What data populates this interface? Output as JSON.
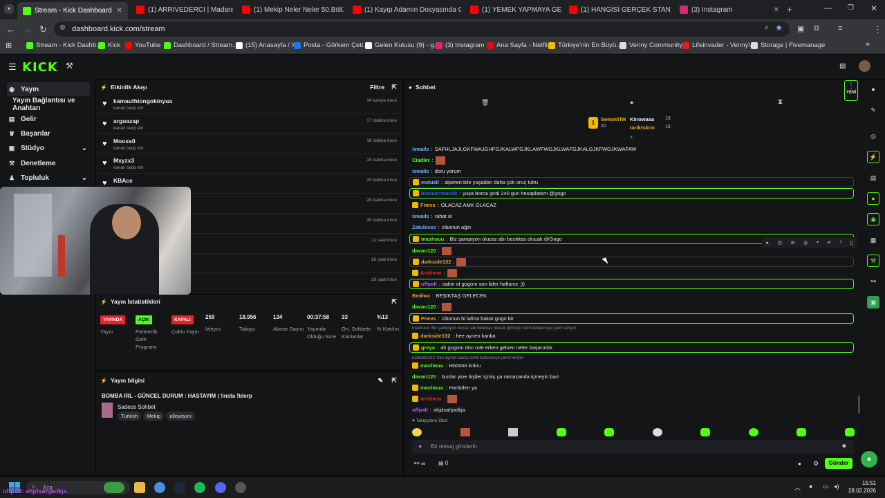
{
  "browser": {
    "tabs": [
      {
        "label": "Stream - Kick Dashboard",
        "icon": "kick-icon",
        "color": "#53fc18"
      },
      {
        "label": "(1) ARRIVEDERCI | Madara Oldu",
        "icon": "youtube-icon",
        "color": "#ff0000"
      },
      {
        "label": "(1) Mekip Neler Neler 50.Bölüm",
        "icon": "youtube-icon",
        "color": "#ff0000"
      },
      {
        "label": "(1) Kayıp Adamın Dosyasında G",
        "icon": "youtube-icon",
        "color": "#ff0000"
      },
      {
        "label": "(1) YEMEK YAPMAYA GELDİK, D",
        "icon": "youtube-icon",
        "color": "#ff0000"
      },
      {
        "label": "(1) HANGİSİ GERÇEK STAND-U",
        "icon": "youtube-icon",
        "color": "#ff0000"
      },
      {
        "label": "(3) Instagram",
        "icon": "instagram-icon",
        "color": "#d62976"
      }
    ],
    "url": "dashboard.kick.com/stream",
    "bookmarks": [
      {
        "label": "Stream - Kick Dashb...",
        "color": "#53fc18"
      },
      {
        "label": "Kick",
        "color": "#53fc18"
      },
      {
        "label": "YouTube",
        "color": "#ff0000"
      },
      {
        "label": "Dashboard / Stream...",
        "color": "#53fc18"
      },
      {
        "label": "(15) Anasayfa / X",
        "color": "#ffffff"
      },
      {
        "label": "Posta - Görkem Çeti...",
        "color": "#1e73e8"
      },
      {
        "label": "Gelen Kutusu (9) - g...",
        "color": "#ffffff"
      },
      {
        "label": "(3) Instagram",
        "color": "#d62976"
      },
      {
        "label": "Ana Sayfa - Netflix",
        "color": "#e50914"
      },
      {
        "label": "Türkiye'nin En Büyü...",
        "color": "#f0c000"
      },
      {
        "label": "Venny Community",
        "color": "#dddddd"
      },
      {
        "label": "Lifeinvader - VennyV",
        "color": "#e02020"
      },
      {
        "label": "Storage | Fivemanage",
        "color": "#dddddd"
      }
    ]
  },
  "kick": {
    "logo": "KICK",
    "nav": [
      {
        "label": "Yayın",
        "icon": "broadcast-icon",
        "active": true
      },
      {
        "label": "Yayın Bağlantısı ve Anahtarı",
        "icon": "",
        "active": false
      },
      {
        "label": "Gelir",
        "icon": "money-icon",
        "active": false
      },
      {
        "label": "Başarılar",
        "icon": "trophy-icon",
        "active": false
      },
      {
        "label": "Stüdyo",
        "icon": "studio-icon",
        "active": false
      },
      {
        "label": "Denetleme",
        "icon": "hammer-icon",
        "active": false
      },
      {
        "label": "Topluluk",
        "icon": "community-icon",
        "active": false
      }
    ]
  },
  "activity": {
    "title": "Etkinlik Akışı",
    "filter": "Filtre",
    "events": [
      {
        "name": "kamauthiongokinyua",
        "sub": "kanalı takip etti",
        "time": "34 saniye önce"
      },
      {
        "name": "argoazap",
        "sub": "kanalı takip etti",
        "time": "17 dakika önce"
      },
      {
        "name": "Mooss0",
        "sub": "kanalı takip etti",
        "time": "18 dakika önce"
      },
      {
        "name": "Mxyzx3",
        "sub": "kanalı takip etti",
        "time": "19 dakika önce"
      },
      {
        "name": "KBAce",
        "sub": "",
        "time": "20 dakika önce"
      },
      {
        "name": "",
        "sub": "",
        "time": "28 dakika önce"
      },
      {
        "name": "",
        "sub": "",
        "time": "35 dakika önce"
      },
      {
        "name": "",
        "sub": "",
        "time": "11 saat önce"
      },
      {
        "name": "",
        "sub": "",
        "time": "18 saat önce"
      },
      {
        "name": "",
        "sub": "",
        "time": "18 saat önce"
      }
    ]
  },
  "stats": {
    "title": "Yayın İstatistikleri",
    "badges": [
      {
        "text": "YAYINDA",
        "label": "Yayın",
        "bg": "#e5252a",
        "fg": "#ffffff"
      },
      {
        "text": "AÇIK",
        "label": "Partnerlik Gelir Programı",
        "bg": "#53fc18",
        "fg": "#000000"
      },
      {
        "text": "KAPALI",
        "label": "Çoklu Yayın",
        "bg": "#e5252a",
        "fg": "#ffffff"
      }
    ],
    "values": [
      {
        "value": "259",
        "label": "İzleyici"
      },
      {
        "value": "18.956",
        "label": "Takipçi"
      },
      {
        "value": "134",
        "label": "Abone Sayısı"
      },
      {
        "value": "00:37:58",
        "label": "Yayında Olduğu Süre"
      },
      {
        "value": "33",
        "label": "Ort. Sohbete Katılanlar"
      },
      {
        "value": "%13",
        "label": "% Katılım"
      }
    ]
  },
  "info": {
    "title": "Yayın bilgisi",
    "stream_title": "BOMBA IRL - GÜNCEL DURUM : HASTAYIM | !insta !blerp",
    "category": "Sadece Sohbet",
    "tags": [
      "Turkish",
      "Mekip",
      "alleyayını"
    ]
  },
  "chat": {
    "title": "Sohbet",
    "new_label": "YENİ",
    "top": [
      {
        "name": "SenseiiTR",
        "count": "20",
        "rank": "1"
      },
      {
        "name": "Kinowaaa",
        "count": "16"
      },
      {
        "name": "tariktsknn",
        "count": "16"
      }
    ],
    "messages": [
      {
        "user": "iswails",
        "text": "SAFHLJAJLGKFWAJGHFGJKALWFGJKLAWFWGJKLWAFGJKALGJKFWGJKWAFAW",
        "color": "#6cb3ff",
        "style": "",
        "emote": false
      },
      {
        "user": "Ciadler",
        "text": "",
        "color": "#53fc18",
        "style": "",
        "emote": true
      },
      {
        "user": "iswails",
        "text": "doru yorum",
        "color": "#6cb3ff",
        "style": "",
        "emote": false
      },
      {
        "user": "exduall",
        "text": "alperen bile yuşadan daha çok oruç tuttu",
        "color": "#6cb3ff",
        "style": "dim",
        "emote": false
      },
      {
        "user": "blackarrowv38",
        "text": "yuşa borca girdi 240 gün hesapladım @gogo",
        "color": "#2f6dd8",
        "style": "hl",
        "emote": false
      },
      {
        "user": "Fnevs",
        "text": "OLACAZ AMK OLACAZ",
        "color": "#e8a33b",
        "style": "",
        "emote": false
      },
      {
        "user": "iswails",
        "text": "rahat ol",
        "color": "#6cb3ff",
        "style": "",
        "emote": false
      },
      {
        "user": "Zatulesss",
        "text": "cibonun ağzı",
        "color": "#6cb3ff",
        "style": "",
        "emote": false
      },
      {
        "user": "mashouu",
        "text": "Biz şampiyon olucaz abı besiktas olucak  @Gogo",
        "color": "#53fc18",
        "style": "hl",
        "emote": false
      },
      {
        "user": "davon120",
        "text": "",
        "color": "#53fc18",
        "style": "",
        "emote": true
      },
      {
        "user": "darkside132",
        "text": "",
        "color": "#e8a33b",
        "style": "dim",
        "emote": true
      },
      {
        "user": "Arkthem",
        "text": "",
        "color": "#e5252a",
        "style": "",
        "emote": true
      },
      {
        "user": "offpalt",
        "text": "sakin ol gogom son lider haftanız ;))",
        "color": "#b45cf0",
        "style": "hl",
        "emote": false
      },
      {
        "user": "Bediwc",
        "text": "BEŞİKTAŞ GELECEK",
        "color": "#e8a33b",
        "style": "",
        "emote": false
      },
      {
        "user": "davon120",
        "text": "",
        "color": "#53fc18",
        "style": "",
        "emote": true
      },
      {
        "user": "Fnevs",
        "text": "cibonun bi lafina bakar gogo bir",
        "color": "#e8a33b",
        "style": "hl",
        "emote": false
      },
      {
        "user": "darkside132",
        "text": "hee aynen kanka",
        "color": "#e8a33b",
        "style": "",
        "emote": false
      },
      {
        "user": "greya",
        "text": "ah gogom dün role erken gelsen neler başarırdık",
        "color": "#53fc18",
        "style": "hl",
        "emote": false
      },
      {
        "user": "mashouu",
        "text": "Hööööö knksı",
        "color": "#53fc18",
        "style": "",
        "emote": false
      },
      {
        "user": "davon120",
        "text": "bunlar yine bişiler içmiş ya ramazanda içmeyin bari",
        "color": "#53fc18",
        "style": "",
        "emote": false
      },
      {
        "user": "mashouu",
        "text": "Harbiden ya",
        "color": "#53fc18",
        "style": "",
        "emote": false
      },
      {
        "user": "Arkthem",
        "text": "",
        "color": "#e5252a",
        "style": "",
        "emote": true
      },
      {
        "user": "offpalt",
        "text": "ahjdsahjadkja",
        "color": "#b45cf0",
        "style": "",
        "emote": false
      }
    ],
    "replies": [
      "mashouu: Biz şampiyon olucaz abı besiktas olucak      @Gogo isimli kullanıcıya yanıt veriyor",
      "darkside132: hee aynen kanka isimli kullanıcıya yanıt veriyor"
    ],
    "followers_label": "Takipçilere Özel",
    "input_placeholder": "Bir mesaj gönderin",
    "send_label": "Gönder",
    "footer_count": "0"
  },
  "overlay_caption": "offpalt: ahjdsahjadkja",
  "taskbar": {
    "search": "Ara",
    "time": "15:51",
    "date": "28.02.2026"
  }
}
